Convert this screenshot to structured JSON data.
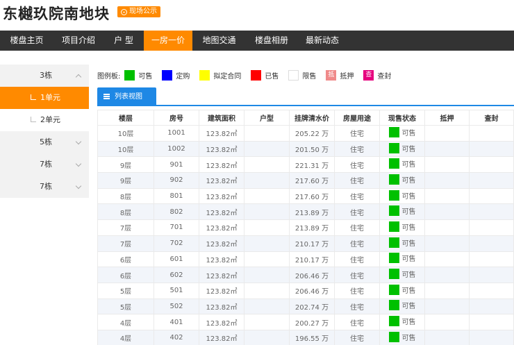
{
  "header": {
    "title": "东樾玖院南地块",
    "notice_label": "现场公示"
  },
  "nav": {
    "items": [
      {
        "label": "楼盘主页",
        "active": false
      },
      {
        "label": "项目介绍",
        "active": false
      },
      {
        "label": "户 型",
        "active": false
      },
      {
        "label": "一房一价",
        "active": true
      },
      {
        "label": "地图交通",
        "active": false
      },
      {
        "label": "楼盘相册",
        "active": false
      },
      {
        "label": "最新动态",
        "active": false
      }
    ]
  },
  "sidebar": {
    "buildings": [
      {
        "label": "3栋",
        "expanded": true,
        "units": [
          "1单元",
          "2单元"
        ],
        "active_unit": "1单元"
      },
      {
        "label": "5栋",
        "expanded": false
      },
      {
        "label": "7栋",
        "expanded": false
      },
      {
        "label": "7栋",
        "expanded": false
      }
    ]
  },
  "legend": {
    "title": "图例板:",
    "items": [
      {
        "label": "可售",
        "color": "#00c000",
        "glyph": ""
      },
      {
        "label": "定购",
        "color": "#0000ff",
        "glyph": ""
      },
      {
        "label": "拟定合同",
        "color": "#ffff00",
        "glyph": ""
      },
      {
        "label": "已售",
        "color": "#ff0000",
        "glyph": ""
      },
      {
        "label": "限售",
        "color": "#ffffff",
        "glyph": ""
      },
      {
        "label": "抵押",
        "color": "#f08a8a",
        "glyph": "抵"
      },
      {
        "label": "查封",
        "color": "#e6007e",
        "glyph": "查"
      }
    ]
  },
  "tabs": {
    "list_view": "列表视图"
  },
  "table": {
    "headers": [
      "楼层",
      "房号",
      "建筑面积",
      "户型",
      "挂牌清水价",
      "房屋用途",
      "现售状态",
      "抵押",
      "查封"
    ],
    "rows": [
      {
        "floor": "10层",
        "room": "1001",
        "area": "123.82㎡",
        "layout": "",
        "price": "205.22 万",
        "use": "住宅",
        "status": "可售",
        "mortgage": "",
        "seized": ""
      },
      {
        "floor": "10层",
        "room": "1002",
        "area": "123.82㎡",
        "layout": "",
        "price": "201.50 万",
        "use": "住宅",
        "status": "可售",
        "mortgage": "",
        "seized": ""
      },
      {
        "floor": "9层",
        "room": "901",
        "area": "123.82㎡",
        "layout": "",
        "price": "221.31 万",
        "use": "住宅",
        "status": "可售",
        "mortgage": "",
        "seized": ""
      },
      {
        "floor": "9层",
        "room": "902",
        "area": "123.82㎡",
        "layout": "",
        "price": "217.60 万",
        "use": "住宅",
        "status": "可售",
        "mortgage": "",
        "seized": ""
      },
      {
        "floor": "8层",
        "room": "801",
        "area": "123.82㎡",
        "layout": "",
        "price": "217.60 万",
        "use": "住宅",
        "status": "可售",
        "mortgage": "",
        "seized": ""
      },
      {
        "floor": "8层",
        "room": "802",
        "area": "123.82㎡",
        "layout": "",
        "price": "213.89 万",
        "use": "住宅",
        "status": "可售",
        "mortgage": "",
        "seized": ""
      },
      {
        "floor": "7层",
        "room": "701",
        "area": "123.82㎡",
        "layout": "",
        "price": "213.89 万",
        "use": "住宅",
        "status": "可售",
        "mortgage": "",
        "seized": ""
      },
      {
        "floor": "7层",
        "room": "702",
        "area": "123.82㎡",
        "layout": "",
        "price": "210.17 万",
        "use": "住宅",
        "status": "可售",
        "mortgage": "",
        "seized": ""
      },
      {
        "floor": "6层",
        "room": "601",
        "area": "123.82㎡",
        "layout": "",
        "price": "210.17 万",
        "use": "住宅",
        "status": "可售",
        "mortgage": "",
        "seized": ""
      },
      {
        "floor": "6层",
        "room": "602",
        "area": "123.82㎡",
        "layout": "",
        "price": "206.46 万",
        "use": "住宅",
        "status": "可售",
        "mortgage": "",
        "seized": ""
      },
      {
        "floor": "5层",
        "room": "501",
        "area": "123.82㎡",
        "layout": "",
        "price": "206.46 万",
        "use": "住宅",
        "status": "可售",
        "mortgage": "",
        "seized": ""
      },
      {
        "floor": "5层",
        "room": "502",
        "area": "123.82㎡",
        "layout": "",
        "price": "202.74 万",
        "use": "住宅",
        "status": "可售",
        "mortgage": "",
        "seized": ""
      },
      {
        "floor": "4层",
        "room": "401",
        "area": "123.82㎡",
        "layout": "",
        "price": "200.27 万",
        "use": "住宅",
        "status": "可售",
        "mortgage": "",
        "seized": ""
      },
      {
        "floor": "4层",
        "room": "402",
        "area": "123.82㎡",
        "layout": "",
        "price": "196.55 万",
        "use": "住宅",
        "status": "可售",
        "mortgage": "",
        "seized": ""
      }
    ]
  }
}
